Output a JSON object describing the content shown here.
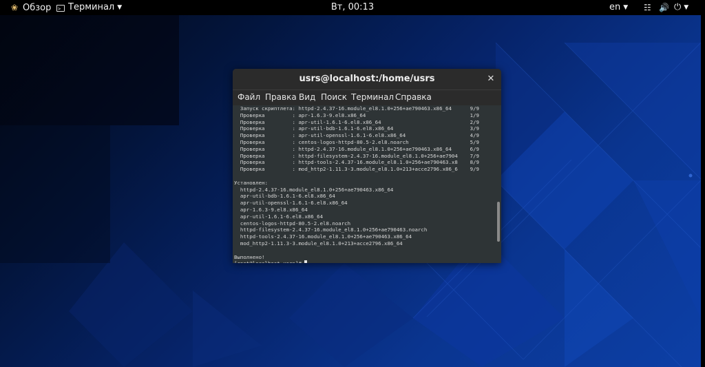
{
  "topbar": {
    "activities": "Обзор",
    "app_menu": "Терминал",
    "clock": "Вт, 00:13",
    "language": "en"
  },
  "icons": {
    "activities": "gnome-foot-icon",
    "app": "terminal-icon",
    "network": "network-icon",
    "volume": "volume-icon",
    "power": "power-icon",
    "close": "close-icon"
  },
  "window": {
    "title": "usrs@localhost:/home/usrs",
    "menu": [
      "Файл",
      "Правка",
      "Вид",
      "Поиск",
      "Терминал",
      "Справка"
    ],
    "scroll_position": 0.84
  },
  "terminal": {
    "lines": [
      "  Запуск скриптлета: httpd-2.4.37-16.module_el8.1.0+256+ae790463.x86_64      9/9",
      "  Проверка         : apr-1.6.3-9.el8.x86_64                                  1/9",
      "  Проверка         : apr-util-1.6.1-6.el8.x86_64                             2/9",
      "  Проверка         : apr-util-bdb-1.6.1-6.el8.x86_64                         3/9",
      "  Проверка         : apr-util-openssl-1.6.1-6.el8.x86_64                     4/9",
      "  Проверка         : centos-logos-httpd-80.5-2.el8.noarch                    5/9",
      "  Проверка         : httpd-2.4.37-16.module_el8.1.0+256+ae790463.x86_64      6/9",
      "  Проверка         : httpd-filesystem-2.4.37-16.module_el8.1.0+256+ae7904    7/9",
      "  Проверка         : httpd-tools-2.4.37-16.module_el8.1.0+256+ae790463.x8    8/9",
      "  Проверка         : mod_http2-1.11.3-3.module_el8.1.0+213+acce2796.x86_6    9/9",
      "",
      "Установлен:",
      "  httpd-2.4.37-16.module_el8.1.0+256+ae790463.x86_64",
      "  apr-util-bdb-1.6.1-6.el8.x86_64",
      "  apr-util-openssl-1.6.1-6.el8.x86_64",
      "  apr-1.6.3-9.el8.x86_64",
      "  apr-util-1.6.1-6.el8.x86_64",
      "  centos-logos-httpd-80.5-2.el8.noarch",
      "  httpd-filesystem-2.4.37-16.module_el8.1.0+256+ae790463.noarch",
      "  httpd-tools-2.4.37-16.module_el8.1.0+256+ae790463.x86_64",
      "  mod_http2-1.11.3-3.module_el8.1.0+213+acce2796.x86_64",
      "",
      "Выполнено!"
    ],
    "prompt": "[root@localhost usrs]# "
  }
}
